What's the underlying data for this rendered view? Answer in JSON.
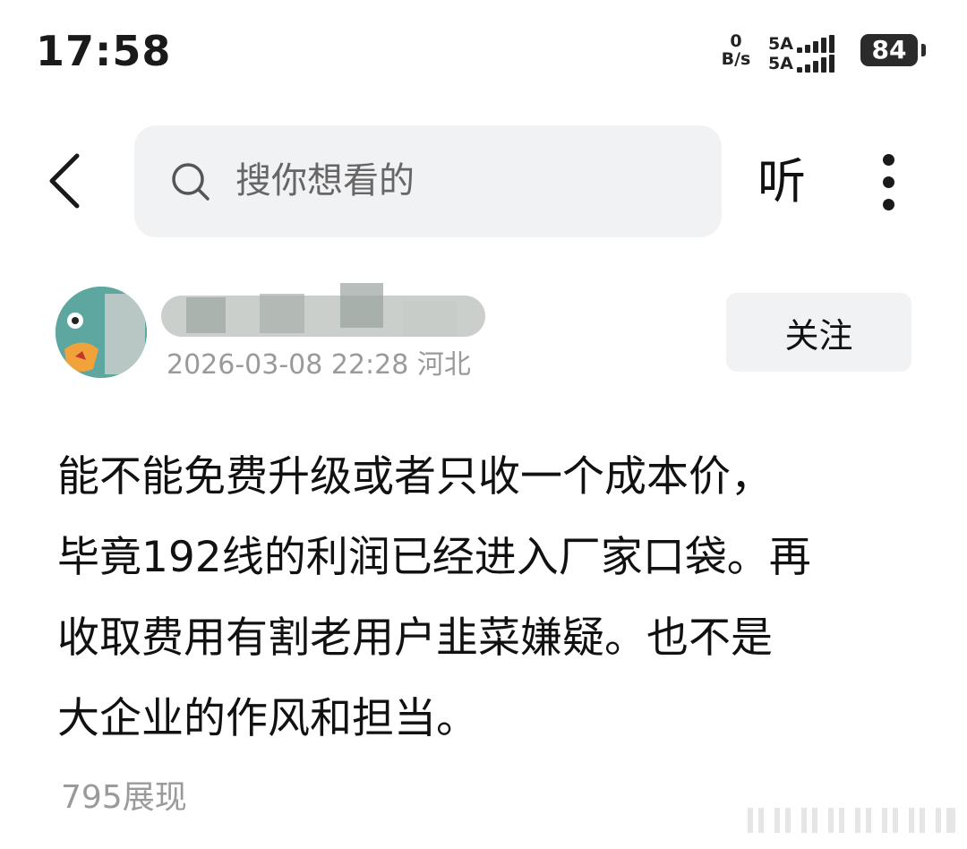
{
  "status_bar": {
    "time": "17:58",
    "net_speed_value": "0",
    "net_speed_unit": "B/s",
    "signal_1_label": "5A",
    "signal_2_label": "5A",
    "battery_level": "84"
  },
  "nav": {
    "back_icon": "chevron-left-icon",
    "search_placeholder": "搜你想看的",
    "listen_label": "听",
    "more_icon": "more-vertical-icon"
  },
  "author": {
    "avatar_icon": "avatar-icon",
    "post_meta": "2026-03-08 22:28 河北",
    "follow_label": "关注"
  },
  "post": {
    "lines": [
      "能不能免费升级或者只收一个成本价，",
      "毕竟192线的利润已经进入厂家口袋。再",
      "收取费用有割老用户韭菜嫌疑。也不是",
      "大企业的作风和担当。"
    ],
    "views": "795展现"
  },
  "colors": {
    "background": "#ffffff",
    "text": "#111111",
    "muted": "#9a9a9a",
    "surface": "#f1f2f4"
  }
}
